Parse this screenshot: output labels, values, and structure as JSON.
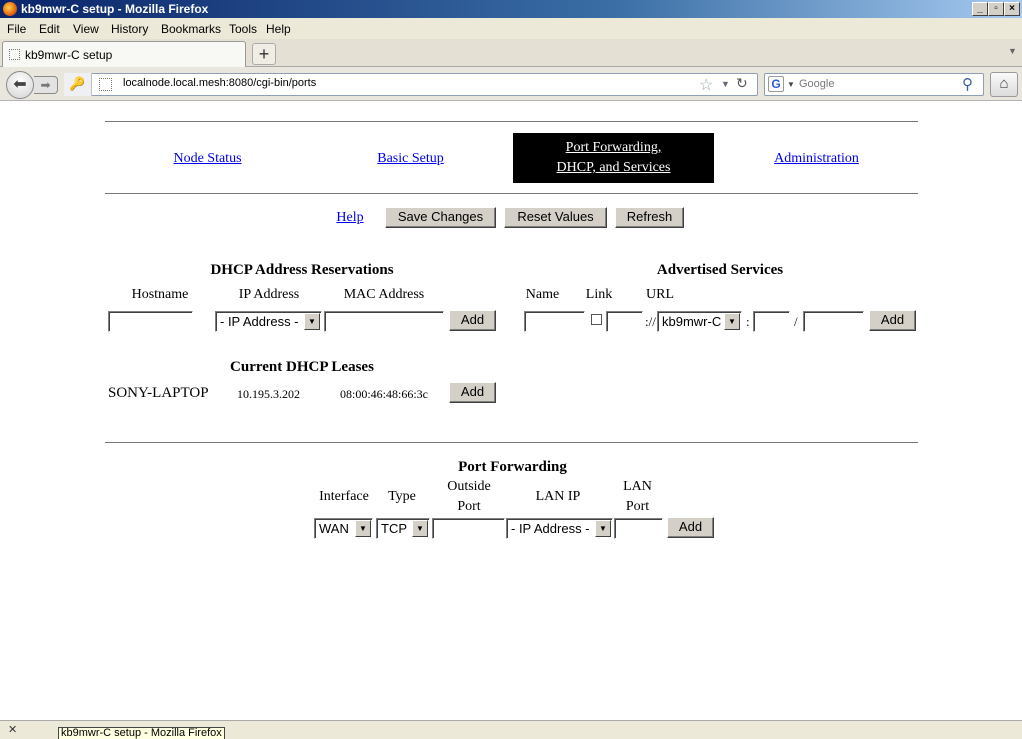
{
  "window": {
    "title": "kb9mwr-C setup - Mozilla Firefox"
  },
  "menu": [
    "File",
    "Edit",
    "View",
    "History",
    "Bookmarks",
    "Tools",
    "Help"
  ],
  "tab": {
    "label": "kb9mwr-C setup"
  },
  "address": {
    "url": "localnode.local.mesh:8080/cgi-bin/ports"
  },
  "search": {
    "engine": "Google"
  },
  "nav": {
    "node_status": "Node Status",
    "basic_setup": "Basic Setup",
    "port_fwd_line1": "Port Forwarding,",
    "port_fwd_line2": "DHCP, and Services",
    "administration": "Administration"
  },
  "actions": {
    "help": "Help",
    "save": "Save Changes",
    "reset": "Reset Values",
    "refresh": "Refresh"
  },
  "dhcp": {
    "title": "DHCP Address Reservations",
    "col_hostname": "Hostname",
    "col_ip": "IP Address",
    "col_mac": "MAC Address",
    "ip_select": "- IP Address -",
    "add": "Add"
  },
  "services": {
    "title": "Advertised Services",
    "col_name": "Name",
    "col_link": "Link",
    "col_url": "URL",
    "scheme_sep": "://",
    "host_select": "kb9mwr-C",
    "port_sep": ":",
    "path_sep": "/",
    "add": "Add"
  },
  "leases": {
    "title": "Current DHCP Leases",
    "rows": [
      {
        "host": "SONY-LAPTOP",
        "ip": "10.195.3.202",
        "mac": "08:00:46:48:66:3c",
        "add": "Add"
      }
    ]
  },
  "portfwd": {
    "title": "Port Forwarding",
    "col_interface": "Interface",
    "col_type": "Type",
    "col_outside_1": "Outside",
    "col_outside_2": "Port",
    "col_lanip": "LAN IP",
    "col_lanport_1": "LAN",
    "col_lanport_2": "Port",
    "interface_select": "WAN",
    "type_select": "TCP",
    "lanip_select": "- IP Address -",
    "add": "Add"
  },
  "status": {
    "tooltip": "kb9mwr-C setup - Mozilla Firefox"
  }
}
